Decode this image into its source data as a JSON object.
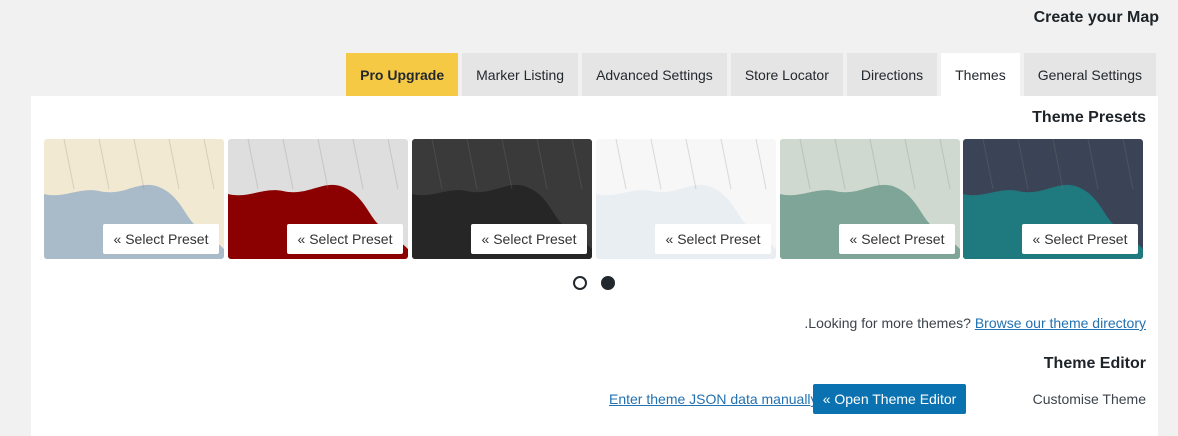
{
  "page_title": "Create your Map",
  "tabs": [
    {
      "label": "General Settings",
      "active": false
    },
    {
      "label": "Themes",
      "active": true
    },
    {
      "label": "Directions",
      "active": false
    },
    {
      "label": "Store Locator",
      "active": false
    },
    {
      "label": "Advanced Settings",
      "active": false
    },
    {
      "label": "Marker Listing",
      "active": false
    },
    {
      "label": "Pro Upgrade",
      "active": false,
      "highlight": "#f6c944"
    }
  ],
  "theme_presets": {
    "title": "Theme Presets",
    "select_label": "« Select Preset",
    "presets": [
      {
        "name": "default-map",
        "land": "#f1e9d2",
        "water": "#a9bac8"
      },
      {
        "name": "red-map",
        "land": "#dedede",
        "water": "#8b0000"
      },
      {
        "name": "dark-map",
        "land": "#3a3a3a",
        "water": "#262626"
      },
      {
        "name": "light-map",
        "land": "#f7f7f7",
        "water": "#e9eef2"
      },
      {
        "name": "green-map",
        "land": "#cfd9cf",
        "water": "#7ea598"
      },
      {
        "name": "navy-map",
        "land": "#3b4456",
        "water": "#1f7a7f"
      }
    ],
    "page_count": 2,
    "current_page": 2
  },
  "more_themes": {
    "text": ".Looking for more themes?",
    "link": "Browse our theme directory"
  },
  "theme_editor": {
    "title": "Theme Editor",
    "json_link": "Enter theme JSON data manually",
    "open_button": "« Open Theme Editor",
    "label": "Customise Theme"
  }
}
